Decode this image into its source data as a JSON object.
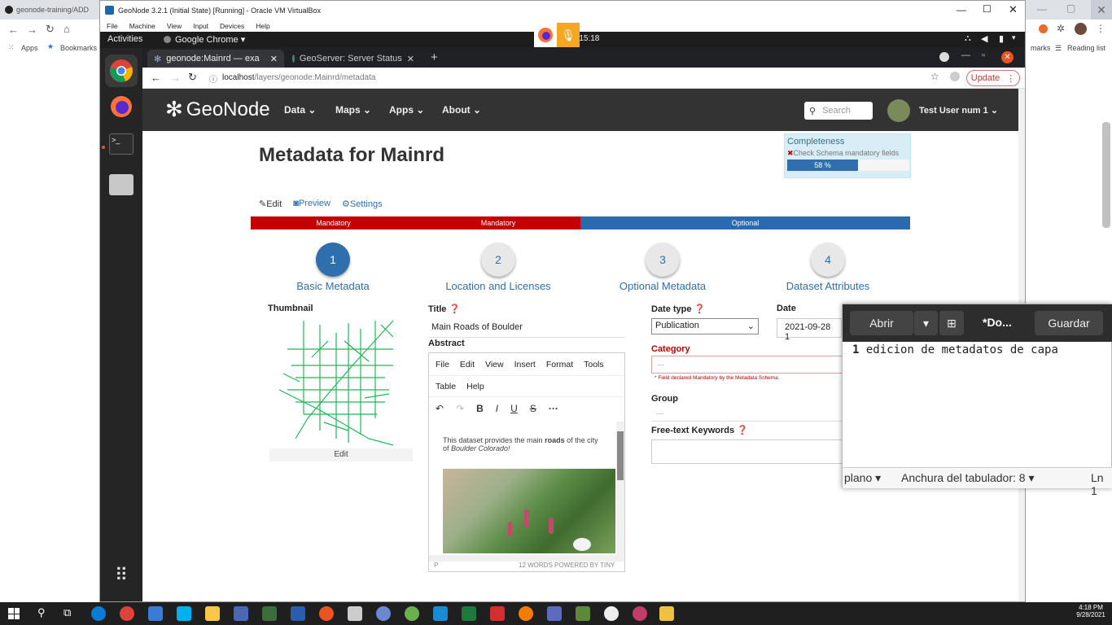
{
  "host": {
    "tab_title": "geonode-training/ADD",
    "bookmarks": {
      "apps": "Apps",
      "bookmarks": "Bookmarks",
      "marks": "marks",
      "reading_list": "Reading list"
    }
  },
  "vbox": {
    "title": "GeoNode 3.2.1 (Initial State) [Running] - Oracle VM VirtualBox",
    "menu": [
      "File",
      "Machine",
      "View",
      "Input",
      "Devices",
      "Help"
    ]
  },
  "gnome": {
    "activities": "Activities",
    "app": "Google Chrome ▾",
    "clock": "p 15:18"
  },
  "browser": {
    "tabs": [
      {
        "title": "geonode:Mainrd — exa"
      },
      {
        "title": "GeoServer: Server Status"
      }
    ],
    "url_host": "localhost",
    "url_path": "/layers/geonode:Mainrd/metadata",
    "update_label": "Update"
  },
  "geonode": {
    "logo": "GeoNode",
    "nav": [
      "Data",
      "Maps",
      "Apps",
      "About"
    ],
    "search_placeholder": "Search",
    "user": "Test User num 1"
  },
  "metadata": {
    "heading": "Metadata for Mainrd",
    "completeness_title": "Completeness",
    "completeness_warning": "Check Schema mandatory fields",
    "completeness_percent": "58 %",
    "completeness_value": 0.58,
    "tabs": {
      "edit": "Edit",
      "preview": "Preview",
      "settings": "Settings"
    },
    "bar": {
      "mandatory1": "Mandatory",
      "mandatory2": "Mandatory",
      "optional": "Optional"
    },
    "steps": [
      {
        "num": "1",
        "label": "Basic Metadata"
      },
      {
        "num": "2",
        "label": "Location and Licenses"
      },
      {
        "num": "3",
        "label": "Optional Metadata"
      },
      {
        "num": "4",
        "label": "Dataset Attributes"
      }
    ],
    "thumbnail_label": "Thumbnail",
    "thumbnail_edit": "Edit",
    "title_label": "Title",
    "title_value": "Main Roads of Boulder",
    "abstract_label": "Abstract",
    "editor_menu1": [
      "File",
      "Edit",
      "View",
      "Insert",
      "Format",
      "Tools"
    ],
    "editor_menu2": [
      "Table",
      "Help"
    ],
    "abstract_text_a": "This dataset provides the main ",
    "abstract_text_b": "roads",
    "abstract_text_c": " of the city of ",
    "abstract_text_d": "Boulder Colorado!",
    "editor_status_left": "P",
    "editor_status_right": "12 WORDS  POWERED BY TINY",
    "datetype_label": "Date type",
    "datetype_value": "Publication",
    "date_label": "Date",
    "date_value": "2021-09-28 1",
    "category_label": "Category",
    "category_placeholder": "---",
    "category_note": "* Field declared Mandatory by the Metadata Schema",
    "group_label": "Group",
    "group_placeholder": "---",
    "keywords_label": "Free-text Keywords"
  },
  "gedit": {
    "open": "Abrir",
    "doc": "*Do...",
    "save": "Guardar",
    "line_no": "1",
    "line_text": "edicion de metadatos de capa",
    "status_mode": "plano ▾",
    "status_tab": "Anchura del tabulador: 8 ▾",
    "status_ln": "Ln 1"
  },
  "taskbar": {
    "time": "4:18 PM",
    "date": "9/28/2021"
  },
  "colors": {
    "mandatory": "#c40000",
    "optional": "#2a6ab0",
    "geonode_nav": "#333333",
    "step_text": "#2f6fad"
  }
}
